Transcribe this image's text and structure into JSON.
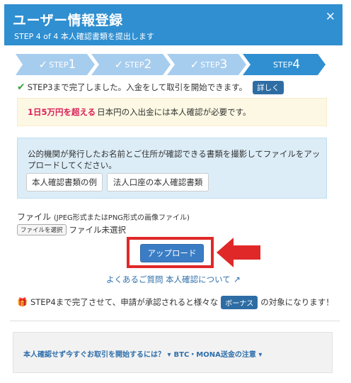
{
  "header": {
    "title": "ユーザー情報登録",
    "subtitle": "STEP 4 of 4 本人確認書類を提出します",
    "close_symbol": "✕"
  },
  "steps": [
    {
      "check": "✓",
      "label": "STEP",
      "num": "1",
      "done": true
    },
    {
      "check": "✓",
      "label": "STEP",
      "num": "2",
      "done": true
    },
    {
      "check": "✓",
      "label": "STEP",
      "num": "3",
      "done": true
    },
    {
      "check": "",
      "label": "STEP",
      "num": "4",
      "done": false,
      "active": true
    }
  ],
  "colors": {
    "header_bg": "#2f8fd1",
    "step_done": "#a7cdee",
    "step_active": "#2f8fd1",
    "accent_red": "#e02828",
    "button_blue": "#3b7dc4"
  },
  "notice": {
    "check_symbol": "✔",
    "text": "STEP3まで完了しました。入金をして取引を開始できます。",
    "detail_button": "詳しく"
  },
  "warning": {
    "emphasis": "1日5万円を超える",
    "text": "日本円の入出金には本人確認が必要です。"
  },
  "info": {
    "text": "公的機関が発行したお名前とご住所が確認できる書類を撮影してファイルをアップロードしてください。",
    "button_examples": "本人確認書類の例",
    "button_corporate": "法人口座の本人確認書類"
  },
  "file": {
    "label": "ファイル",
    "hint": "(JPEG形式またはPNG形式の画像ファイル)",
    "choose_button": "ファイルを選択",
    "status": "ファイル未選択"
  },
  "upload_button": "アップロード",
  "faq": {
    "text": "よくあるご質問 本人確認について",
    "icon": "external-link-icon"
  },
  "promo": {
    "icon": "gift-icon",
    "before": "STEP4まで完了させて、申請が承認されると様々な",
    "bonus": "ボーナス",
    "after": "の対象になります！"
  },
  "footer": {
    "link1": "本人確認せず今すぐお取引を開始するには？ ▾",
    "link2": "BTC・MONA送金の注意 ▾"
  }
}
